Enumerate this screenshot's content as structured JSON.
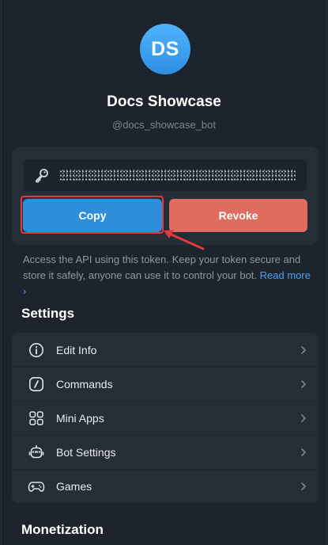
{
  "bot": {
    "avatar_initials": "DS",
    "name": "Docs Showcase",
    "username": "@docs_showcase_bot"
  },
  "token": {
    "masked": true,
    "copy_label": "Copy",
    "revoke_label": "Revoke",
    "help_text": "Access the API using this token. Keep your token secure and store it safely, anyone can use it to control your bot.",
    "read_more_label": "Read more ›"
  },
  "settings": {
    "title": "Settings",
    "items": [
      {
        "label": "Edit Info",
        "icon": "info-icon"
      },
      {
        "label": "Commands",
        "icon": "slash-command-icon"
      },
      {
        "label": "Mini Apps",
        "icon": "apps-grid-icon"
      },
      {
        "label": "Bot Settings",
        "icon": "bot-icon"
      },
      {
        "label": "Games",
        "icon": "gamepad-icon"
      }
    ]
  },
  "monetization": {
    "title": "Monetization"
  },
  "colors": {
    "background": "#1d242d",
    "card": "#252d37",
    "copy_button": "#2f8ed9",
    "revoke_button": "#e06c5f",
    "link": "#4ea3ef",
    "annotation": "#e0393e"
  }
}
